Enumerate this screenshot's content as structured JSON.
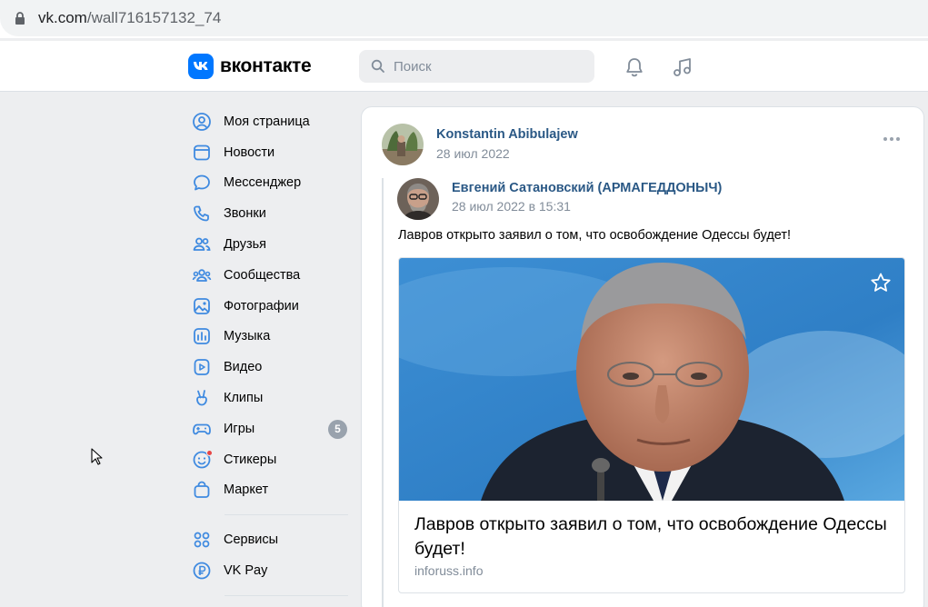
{
  "browser": {
    "url_host": "vk.com",
    "url_path": "/wall716157132_74"
  },
  "header": {
    "logo_text": "вконтакте",
    "search_placeholder": "Поиск"
  },
  "nav": {
    "items": [
      {
        "label": "Моя страница",
        "icon": "user-circle-icon"
      },
      {
        "label": "Новости",
        "icon": "news-icon"
      },
      {
        "label": "Мессенджер",
        "icon": "message-icon"
      },
      {
        "label": "Звонки",
        "icon": "phone-icon"
      },
      {
        "label": "Друзья",
        "icon": "friends-icon"
      },
      {
        "label": "Сообщества",
        "icon": "communities-icon"
      },
      {
        "label": "Фотографии",
        "icon": "photo-icon"
      },
      {
        "label": "Музыка",
        "icon": "music-icon"
      },
      {
        "label": "Видео",
        "icon": "video-icon"
      },
      {
        "label": "Клипы",
        "icon": "clips-icon"
      },
      {
        "label": "Игры",
        "icon": "games-icon",
        "badge": "5"
      },
      {
        "label": "Стикеры",
        "icon": "sticker-icon"
      },
      {
        "label": "Маркет",
        "icon": "market-icon"
      }
    ],
    "extra": [
      {
        "label": "Сервисы",
        "icon": "services-icon"
      },
      {
        "label": "VK Pay",
        "icon": "vkpay-icon"
      }
    ]
  },
  "post": {
    "author": "Konstantin Abibulajew",
    "date": "28 июл 2022",
    "repost": {
      "author": "Евгений Сатановский (АРМАГЕДДОНЫЧ)",
      "date": "28 июл 2022 в 15:31",
      "text": "Лавров открыто заявил о том, что освобождение Одессы будет!",
      "link": {
        "title": "Лавров открыто заявил о том, что освобождение Одессы будет!",
        "domain": "inforuss.info"
      }
    }
  },
  "colors": {
    "accent": "#0077ff",
    "link": "#2a5885",
    "icon": "#3f8ae0",
    "secondary": "#818c99"
  }
}
